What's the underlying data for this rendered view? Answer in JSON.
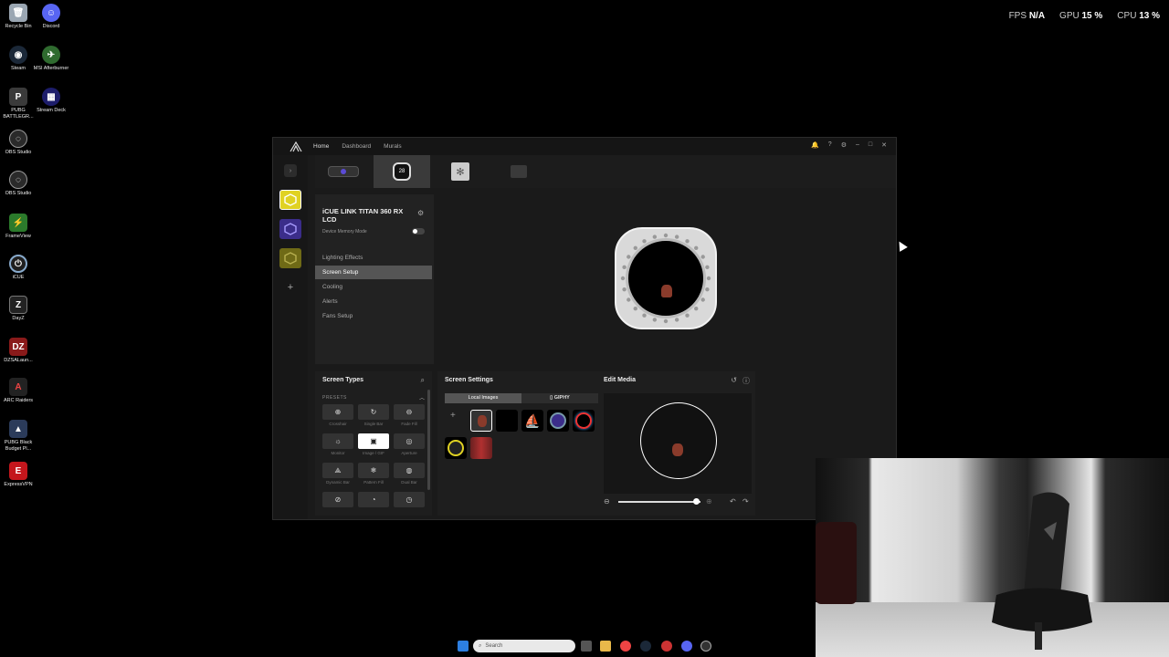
{
  "desktop": {
    "icons": [
      {
        "label": "Recycle Bin",
        "icon": "recycle-bin-icon",
        "color": "#9aa6b2"
      },
      {
        "label": "Discord",
        "icon": "discord-icon",
        "color": "#5865f2"
      },
      {
        "label": "Steam",
        "icon": "steam-icon",
        "color": "#1b2838"
      },
      {
        "label": "MSI Afterburner",
        "icon": "msi-afterburner-icon",
        "color": "#2f6b2f"
      },
      {
        "label": "PUBG BATTLEGR...",
        "icon": "pubg-icon",
        "color": "#3a3a3a"
      },
      {
        "label": "Stream Deck",
        "icon": "stream-deck-icon",
        "color": "#1d1d6b"
      },
      {
        "label": "OBS Studio",
        "icon": "obs-icon",
        "color": "#2a2a2a"
      },
      {
        "label": "OBS Studio",
        "icon": "obs-icon",
        "color": "#2a2a2a"
      },
      {
        "label": "FrameView",
        "icon": "frameview-icon",
        "color": "#2b7a2b"
      },
      {
        "label": "iCUE",
        "icon": "icue-icon",
        "color": "#1f1f1f"
      },
      {
        "label": "DayZ",
        "icon": "dayz-icon",
        "color": "#222"
      },
      {
        "label": "DZSALaun...",
        "icon": "dzsa-icon",
        "color": "#8a1a1a"
      },
      {
        "label": "ARC Raiders",
        "icon": "arc-raiders-icon",
        "color": "#222"
      },
      {
        "label": "PUBG Black Budget Pl...",
        "icon": "pubg-black-budget-icon",
        "color": "#2b3b5a"
      },
      {
        "label": "ExpressVPN",
        "icon": "expressvpn-icon",
        "color": "#c4161c"
      }
    ]
  },
  "overlay": {
    "fps_label": "FPS",
    "fps_value": "N/A",
    "gpu_label": "GPU",
    "gpu_value": "15 %",
    "cpu_label": "CPU",
    "cpu_value": "13 %"
  },
  "app": {
    "nav": [
      "Home",
      "Dashboard",
      "Murals"
    ],
    "device_name": "iCUE LINK TITAN 360 RX LCD",
    "memory_mode": "Device Memory Mode",
    "menu": [
      "Lighting Effects",
      "Screen Setup",
      "Cooling",
      "Alerts",
      "Fans Setup"
    ],
    "active_menu": "Screen Setup",
    "lcd_tab_text": "28",
    "screen_types": {
      "title": "Screen Types",
      "presets_label": "PRESETS",
      "items": [
        "Crosshair",
        "Single Bar",
        "Fade Fill",
        "Monitor",
        "Image / GIF",
        "Aperture",
        "Dynamic Bar",
        "Pattern Fill",
        "Dual Bar",
        "",
        "",
        ""
      ]
    },
    "screen_settings": {
      "title": "Screen Settings",
      "tab_local": "Local Images",
      "tab_giphy": "GIPHY"
    },
    "edit_media": {
      "title": "Edit Media",
      "zoom_level": 0.95
    }
  },
  "taskbar": {
    "search_placeholder": "Search"
  },
  "colors": {
    "accent_yellow": "#e0d223",
    "accent_purple": "#3b2d8a",
    "accent_olive": "#6f6a16"
  }
}
